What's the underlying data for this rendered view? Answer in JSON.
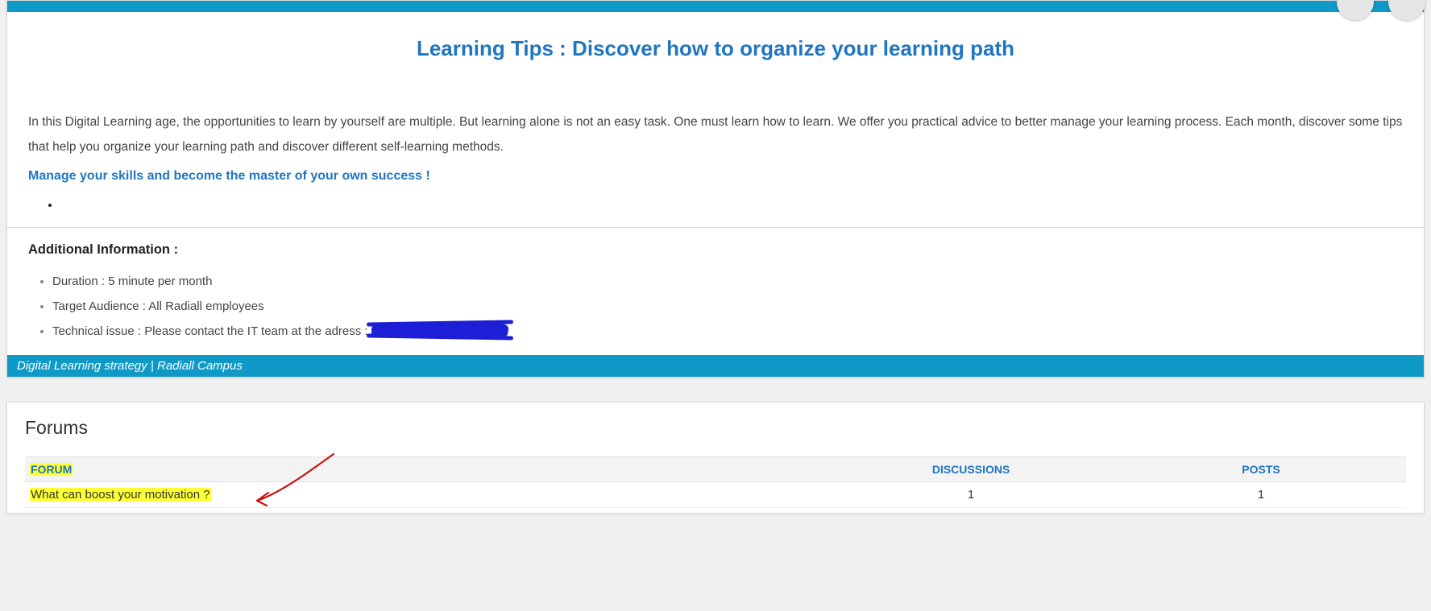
{
  "main": {
    "title": "Learning Tips : Discover how to organize your learning path",
    "intro": "In this Digital Learning age, the opportunities to learn by yourself are multiple. But learning alone is not an easy task. One must learn how to learn. We offer you practical advice to better manage your learning process. Each month, discover some tips that help you organize your learning path and discover different self-learning methods.",
    "tagline": "Manage your skills and become the master of your own success !",
    "additional_heading": "Additional Information :",
    "info_items": {
      "duration": "Duration : 5 minute per month",
      "audience": "Target Audience : All Radiall employees",
      "tech_prefix": "Technical issue : Please contact the IT team at the adress :"
    },
    "footer": "Digital Learning strategy | Radiall Campus"
  },
  "forums": {
    "section_title": "Forums",
    "headers": {
      "forum": "FORUM",
      "discussions": "DISCUSSIONS",
      "posts": "POSTS"
    },
    "rows": [
      {
        "name": "What can boost your motivation ?",
        "discussions": "1",
        "posts": "1"
      }
    ]
  }
}
